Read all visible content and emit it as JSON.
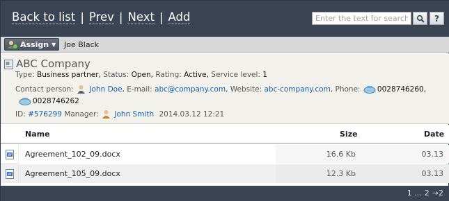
{
  "nav": {
    "back_label": "Back to list",
    "prev_label": "Prev",
    "next_label": "Next",
    "add_label": "Add",
    "separator": "|"
  },
  "search": {
    "placeholder": "Enter the text for search",
    "go_icon": "magnifier-icon",
    "help_label": "?"
  },
  "assign": {
    "button_label": "Assign",
    "assignee": "Joe Black"
  },
  "company": {
    "name": "ABC Company",
    "type_label": "Type:",
    "type_value": "Business partner,",
    "status_label": "Status:",
    "status_value": "Open,",
    "rating_label": "Rating:",
    "rating_value": "Active,",
    "service_label": "Service level:",
    "service_value": "1",
    "contact_label": "Contact person:",
    "contact_value": "John Doe",
    "email_label": ", E-mail:",
    "email_value": "abc@company.com",
    "website_label": ", Website:",
    "website_value": "abc-company.com",
    "phone_label": ", Phone:",
    "phone1": "0028746260,",
    "phone2": "0028746262",
    "id_label": "ID:",
    "id_value": "#576299",
    "manager_label": "Manager:",
    "manager_value": "John Smith",
    "datetime": "2014.03.12 12:21"
  },
  "table": {
    "columns": [
      "Name",
      "Size",
      "Date"
    ],
    "rows": [
      {
        "name": "Agreement_102_09.docx",
        "size": "16.6 Kb",
        "date": "03.13"
      },
      {
        "name": "Agreement_105_09.docx",
        "size": "12.3 Kb",
        "date": "03.13"
      }
    ]
  },
  "pager": {
    "ellipsis": "1 ...",
    "page": "2",
    "next": "→2"
  },
  "colors": {
    "header_bg": "#3a4452",
    "link": "#1a5fa8",
    "info_bg": "#f2f1ec"
  }
}
